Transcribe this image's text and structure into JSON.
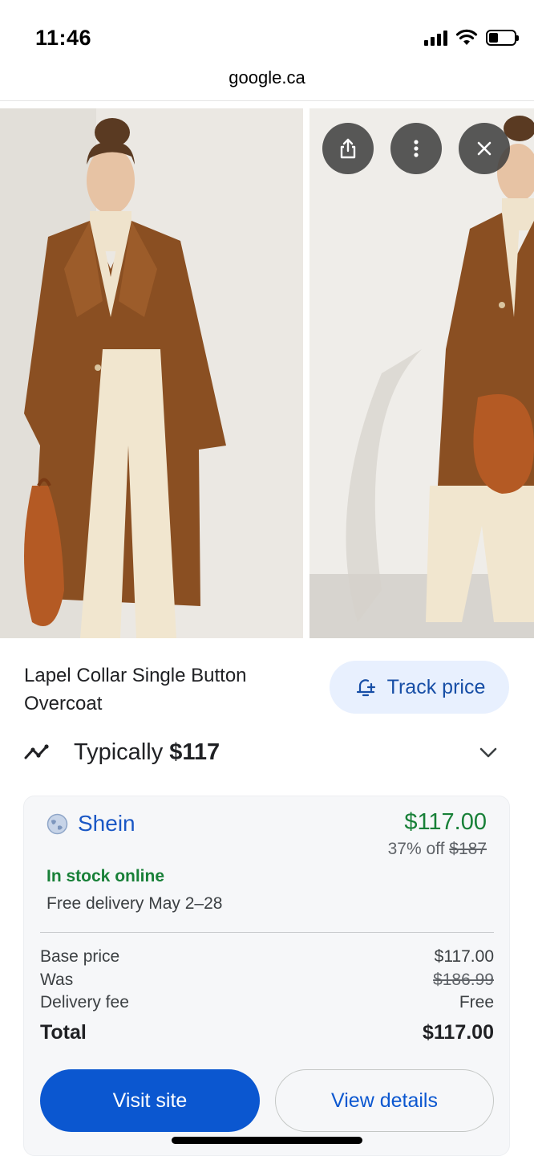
{
  "status_bar": {
    "time": "11:46"
  },
  "browser": {
    "url": "google.ca"
  },
  "gallery": {
    "images": [
      {
        "alt": "Model wearing brown lapel collar overcoat with cream trousers and tan bag"
      },
      {
        "alt": "Model wearing brown overcoat holding tan crescent bag"
      }
    ],
    "buttons": {
      "share_icon": "share-icon",
      "more_icon": "more-vert-icon",
      "close_icon": "close-icon"
    }
  },
  "product": {
    "title": "Lapel Collar Single Button Overcoat",
    "track_price_label": "Track price",
    "typically_label": "Typically",
    "typically_price": "$117"
  },
  "offer": {
    "seller": "Shein",
    "price": "$117.00",
    "discount_text": "37% off",
    "original_price": "$187",
    "stock_status": "In stock online",
    "delivery": "Free delivery May 2–28",
    "breakdown": [
      {
        "label": "Base price",
        "value": "$117.00"
      },
      {
        "label": "Was",
        "value": "$186.99"
      },
      {
        "label": "Delivery fee",
        "value": "Free"
      }
    ],
    "total_label": "Total",
    "total_value": "$117.00",
    "visit_label": "Visit site",
    "details_label": "View details"
  },
  "colors": {
    "accent_blue": "#0b57d0",
    "price_green": "#188038",
    "chip_bg": "#e8f0fe",
    "card_bg": "#f6f7f9"
  }
}
